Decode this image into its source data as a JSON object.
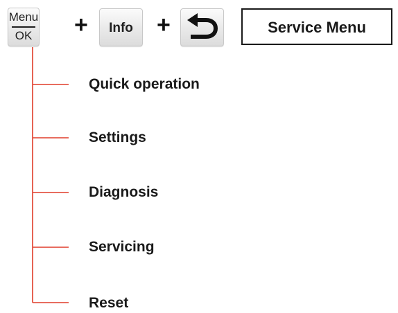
{
  "keys": {
    "menu_top": "Menu",
    "menu_bottom": "OK",
    "plus_1": "+",
    "info": "Info",
    "plus_2": "+"
  },
  "title": "Service Menu",
  "items": [
    {
      "label": "Quick operation"
    },
    {
      "label": "Settings"
    },
    {
      "label": "Diagnosis"
    },
    {
      "label": "Servicing"
    },
    {
      "label": "Reset"
    }
  ],
  "colors": {
    "connector": "#e03c2a",
    "text": "#1a1a1a"
  },
  "icons": {
    "back": "back-arrow-icon"
  }
}
